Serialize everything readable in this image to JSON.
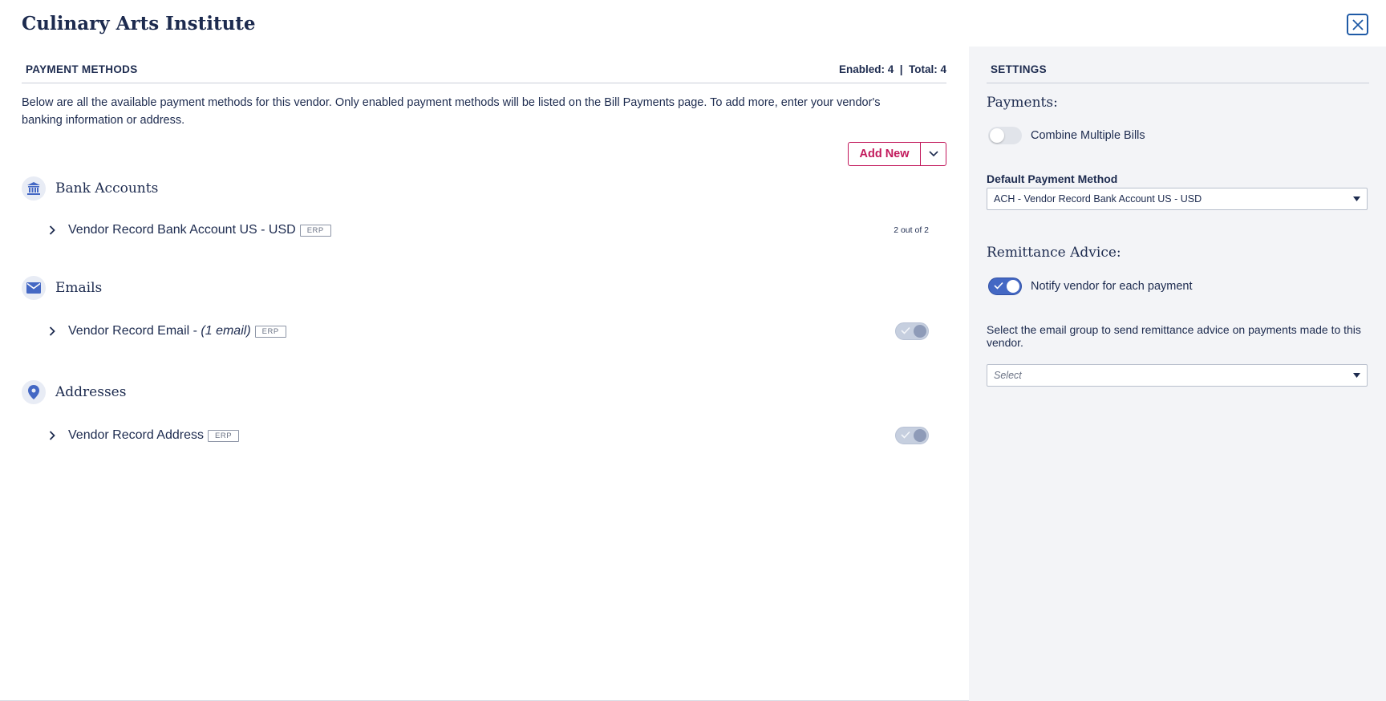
{
  "modal": {
    "title": "Culinary Arts Institute"
  },
  "payment_methods": {
    "heading": "PAYMENT METHODS",
    "counts": "Enabled: 4  |  Total: 4",
    "description": "Below are all the available payment methods for this vendor. Only enabled payment methods will be listed on the Bill Payments page. To add more, enter your vendor's banking information or address.",
    "add_new_label": "Add New",
    "groups": [
      {
        "title": "Bank Accounts",
        "icon": "bank-icon",
        "items": [
          {
            "label": "Vendor Record Bank Account US - USD",
            "badge": "ERP",
            "right_text": "2 out of 2"
          }
        ]
      },
      {
        "title": "Emails",
        "icon": "envelope-icon",
        "items": [
          {
            "label": "Vendor Record Email - ",
            "label_italic": "(1 email)",
            "badge": "ERP",
            "enabled": true
          }
        ]
      },
      {
        "title": "Addresses",
        "icon": "map-pin-icon",
        "items": [
          {
            "label": "Vendor Record Address",
            "badge": "ERP",
            "enabled": true
          }
        ]
      }
    ]
  },
  "settings": {
    "heading": "SETTINGS",
    "payments_heading": "Payments:",
    "combine_label": "Combine Multiple Bills",
    "combine_enabled": false,
    "default_method_label": "Default Payment Method",
    "default_method_value": "ACH - Vendor Record Bank Account US - USD",
    "remittance_heading": "Remittance Advice:",
    "notify_label": "Notify vendor for each payment",
    "notify_enabled": true,
    "email_group_text": "Select the email group to send remittance advice on payments made to this vendor.",
    "email_group_placeholder": "Select"
  },
  "colors": {
    "primary": "#1d2b4f",
    "accent": "#c2185b",
    "toggle_on": "#4468c4",
    "panel_bg": "#f3f4f7"
  }
}
